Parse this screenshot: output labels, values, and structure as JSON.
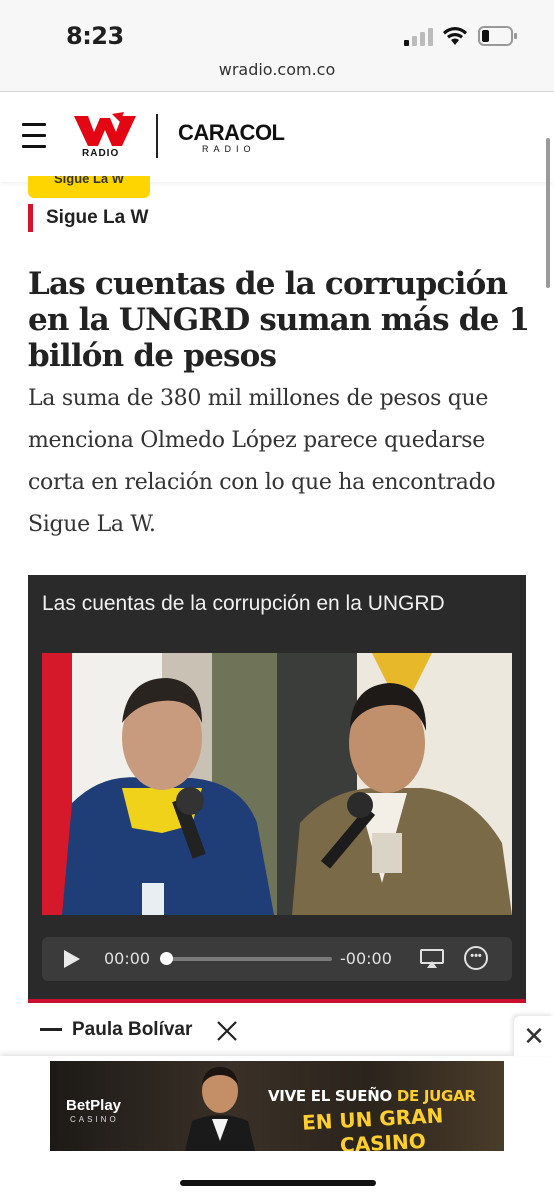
{
  "status_bar": {
    "time": "8:23"
  },
  "browser": {
    "url": "wradio.com.co"
  },
  "header": {
    "logo_w": "RADIO",
    "logo_caracol": "CARACOL",
    "logo_caracol_sub": "RADIO"
  },
  "article": {
    "section_tag": "Sigue La W",
    "section": "Sigue La W",
    "title": "Las cuentas de la corrupción en la UNGRD suman más de 1 billón de pesos",
    "summary": "La suma de 380 mil millones de pesos que menciona Olmedo López parece quedarse corta en relación con lo que ha encontrado Sigue La W.",
    "media_title": "Las cuentas de la corrupción en la UNGRD",
    "player": {
      "current_time": "00:00",
      "remaining_time": "-00:00",
      "progress": 0
    },
    "author": "Paula Bolívar"
  },
  "ad": {
    "brand": "BetPlay",
    "brand_sub": "CASINO",
    "line1_a": "VIVE EL SUEÑO",
    "line1_b": "DE JUGAR",
    "line2": "EN UN GRAN",
    "line3": "CASINO"
  },
  "colors": {
    "accent_red": "#d4142c",
    "tag_yellow": "#ffd500",
    "media_bg": "#2a2a2a"
  }
}
